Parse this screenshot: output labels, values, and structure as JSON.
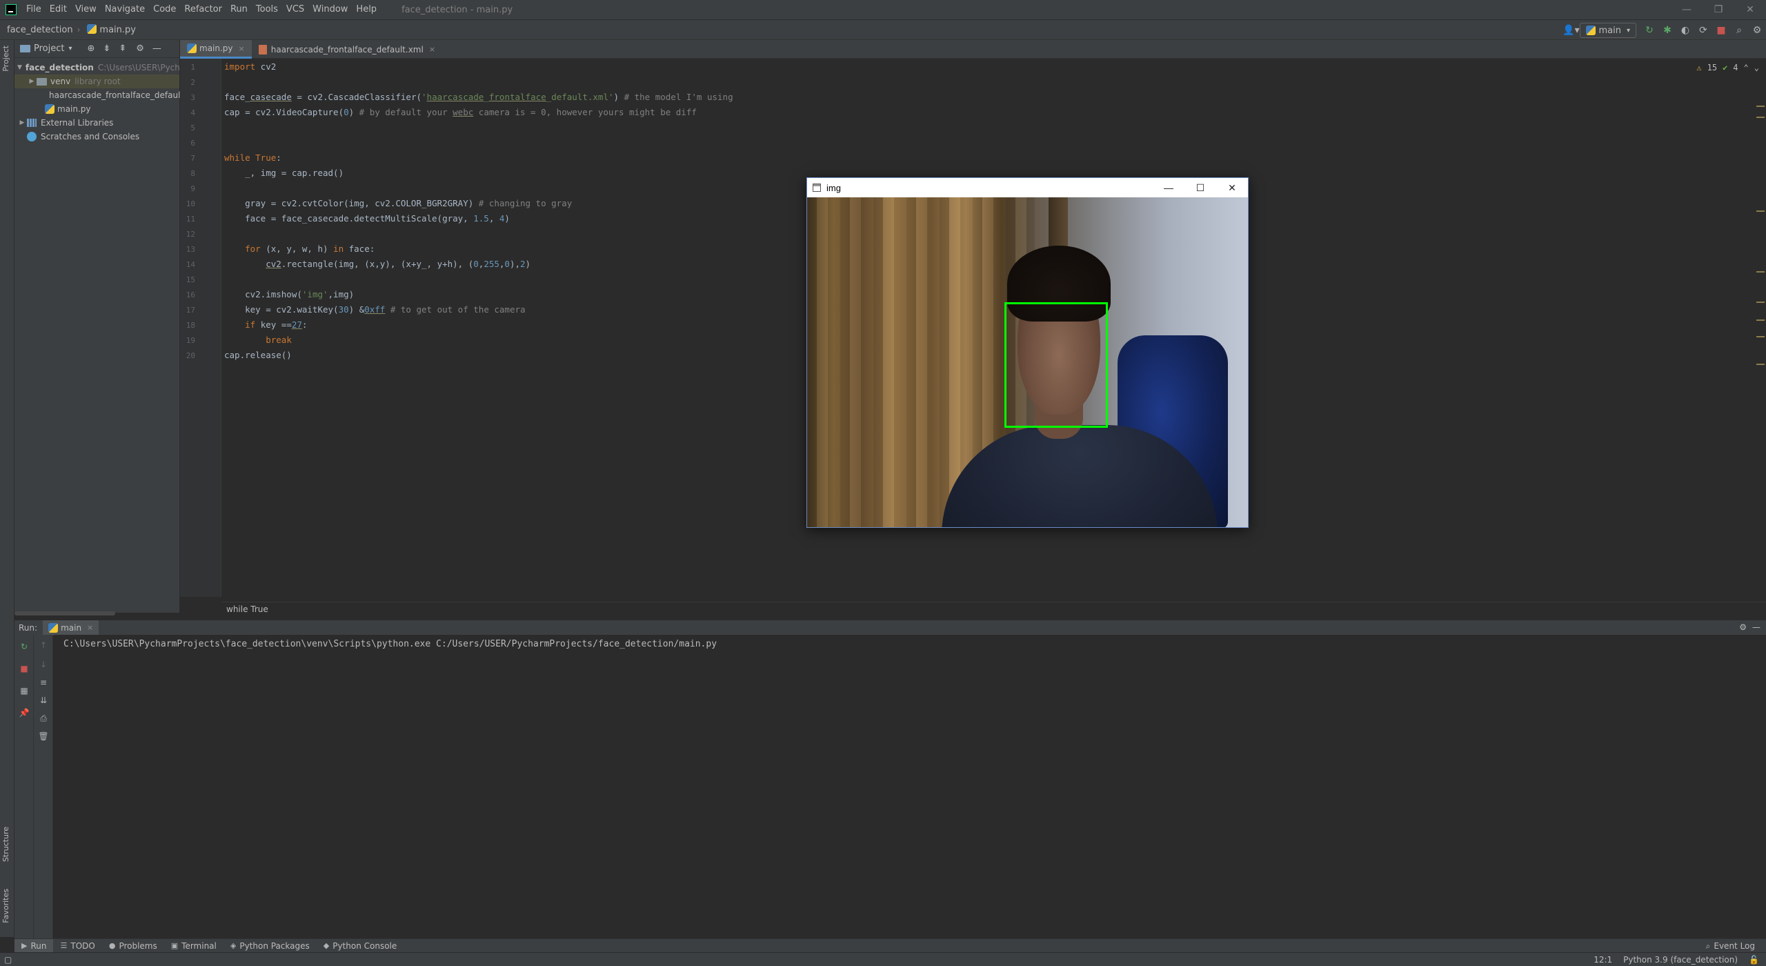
{
  "menubar": {
    "items": [
      "File",
      "Edit",
      "View",
      "Navigate",
      "Code",
      "Refactor",
      "Run",
      "Tools",
      "VCS",
      "Window",
      "Help"
    ],
    "window_title": "face_detection - main.py"
  },
  "navbar": {
    "project": "face_detection",
    "file": "main.py",
    "run_config": "main"
  },
  "project_panel": {
    "title": "Project",
    "root": "face_detection",
    "root_path": "C:\\Users\\USER\\Pych",
    "venv": "venv",
    "venv_note": "library root",
    "xml_file": "haarcascade_frontalface_default.x",
    "main_file": "main.py",
    "external": "External Libraries",
    "scratches": "Scratches and Consoles"
  },
  "editor": {
    "tabs": [
      {
        "label": "main.py",
        "active": true
      },
      {
        "label": "haarcascade_frontalface_default.xml",
        "active": false
      }
    ],
    "inspections": {
      "warnings": "15",
      "ok": "4"
    },
    "breadcrumb": "while True",
    "line_numbers": [
      "1",
      "2",
      "3",
      "4",
      "5",
      "6",
      "7",
      "8",
      "9",
      "10",
      "11",
      "12",
      "13",
      "14",
      "15",
      "16",
      "17",
      "18",
      "19",
      "20"
    ]
  },
  "img_window": {
    "title": "img",
    "minimize": "—",
    "maximize": "☐",
    "close": "✕"
  },
  "run_panel": {
    "label": "Run:",
    "tab": "main",
    "console_output": "C:\\Users\\USER\\PycharmProjects\\face_detection\\venv\\Scripts\\python.exe C:/Users/USER/PycharmProjects/face_detection/main.py"
  },
  "left_strip": {
    "project": "Project",
    "structure": "Structure",
    "favorites": "Favorites"
  },
  "bottom_tabs": [
    {
      "label": "Run",
      "icon": "▶",
      "active": true
    },
    {
      "label": "TODO",
      "icon": "☰",
      "active": false
    },
    {
      "label": "Problems",
      "icon": "●",
      "active": false
    },
    {
      "label": "Terminal",
      "icon": "▣",
      "active": false
    },
    {
      "label": "Python Packages",
      "icon": "◈",
      "active": false
    },
    {
      "label": "Python Console",
      "icon": "◆",
      "active": false
    }
  ],
  "event_log": "Event Log",
  "statusbar": {
    "position": "12:1",
    "interpreter": "Python 3.9 (face_detection)"
  },
  "colors": {
    "accent": "#4a88c7",
    "keyword": "#cc7832",
    "string": "#6a8759",
    "number": "#6897bb",
    "comment": "#808080",
    "detection_box": "#00ff00"
  }
}
